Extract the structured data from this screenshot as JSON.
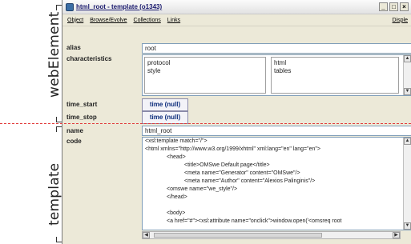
{
  "annotations": {
    "web_element": "webElement",
    "template": "template"
  },
  "window": {
    "title": "html_root - template (o1343)",
    "buttons": [
      "_",
      "□",
      "×"
    ]
  },
  "menu": {
    "items": [
      "Object",
      "Browse/Evolve",
      "Collections",
      "Links"
    ],
    "right": "Disple"
  },
  "fields": {
    "alias_label": "alias",
    "alias_value": "root",
    "characteristics_label": "characteristics",
    "characteristics_left": [
      "protocol",
      "style"
    ],
    "characteristics_right": [
      "html",
      "tables"
    ],
    "time_start_label": "time_start",
    "time_start_value": "time (null)",
    "time_stop_label": "time_stop",
    "time_stop_value": "time (null)",
    "name_label": "name",
    "name_value": "html_root",
    "code_label": "code"
  },
  "code_lines": [
    "<xsl:template match=\"/\">",
    "<html xmlns=\"http://www.w3.org/1999/xhtml\" xml:lang=\"en\" lang=\"en\">",
    "<head>",
    "<title>OMSwe Default page</title>",
    "<meta name=\"Generator\" content=\"OMSwe\"/>",
    "<meta name=\"Author\" content=\"Alexios Palinginis\"/>",
    "<omswe name=\"we_style\"/>",
    "</head>",
    "",
    "<body>",
    "<a href=\"#\"><xsl:attribute name=\"onclick\">window.open('<omsreq root"
  ],
  "colors": {
    "divider": "#e23a3a",
    "time_button_text": "#0a2b7a",
    "field_border": "#7f9db9"
  }
}
